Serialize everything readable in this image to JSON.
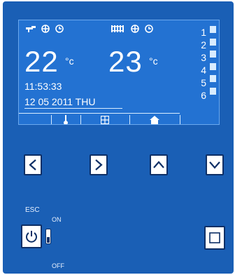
{
  "display": {
    "status_icons_left": [
      "faucet-icon",
      "fan-icon",
      "clock-icon"
    ],
    "status_icons_right": [
      "radiator-icon",
      "fan-icon",
      "clock-icon"
    ],
    "temp_left": "22",
    "temp_left_unit": "°c",
    "temp_right": "23",
    "temp_right_unit": "°c",
    "time": "11:53:33",
    "date": "12 05 2011 THU",
    "channel_numbers": [
      "1",
      "2",
      "3",
      "4",
      "5",
      "6"
    ],
    "tabs": [
      "thermometer-icon",
      "grid-icon",
      "home-icon"
    ]
  },
  "controls": {
    "esc_label": "ESC",
    "on_label": "ON",
    "off_label": "OFF",
    "nav_buttons": [
      "left-arrow",
      "right-arrow",
      "up-arrow",
      "down-arrow"
    ]
  },
  "colors": {
    "panel": "#1a5fb5",
    "screen": "#2372d2",
    "button_border": "#0d2f66"
  }
}
